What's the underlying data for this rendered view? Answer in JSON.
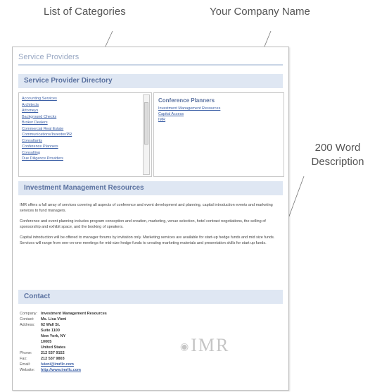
{
  "callouts": {
    "categories": "List of Categories",
    "company": "Your Company Name",
    "description_line1": "200 Word",
    "description_line2": "Description"
  },
  "page": {
    "title": "Service Providers"
  },
  "directory": {
    "heading": "Service Provider Directory",
    "categories": [
      "Accounting Services",
      "Architects",
      "Attorneys",
      "Background Checks",
      "Broker Dealers",
      "Commercial Real Estate",
      "Communications/Investor/PR",
      "Consultants",
      "Conference Planners",
      "Consulting",
      "Due Diligence Providers"
    ],
    "selected": {
      "title": "Conference Planners",
      "links": [
        "Investment Management Resources",
        "Capital Access",
        "IMR"
      ]
    }
  },
  "description": {
    "heading": "Investment Management Resources",
    "paragraphs": [
      "IMR offers a full array of services covering all aspects of conference and event development and planning, capital introduction events and marketing services to fund managers.",
      "Conference and event planning includes program conception and creation, marketing, venue selection, hotel contract negotiations, the selling of sponsorship and exhibit space, and the booking of speakers.",
      "Capital introduction will be offered to manager forums by invitation only. Marketing services are available for start-up hedge funds and mid size funds. Services will range from one-on-one meetings for mid-size hedge funds to creating marketing materials and presentation skills for start up funds."
    ]
  },
  "contact": {
    "heading": "Contact",
    "rows": [
      {
        "label": "Company:",
        "value": "Investment Management Resources"
      },
      {
        "label": "Contact:",
        "value": "Ms. Lisa Vieni"
      },
      {
        "label": "Address:",
        "value": "62 Wall St.\nSuite 1100\nNew York, NY\n10005\nUnited States"
      },
      {
        "label": "Phone:",
        "value": "212 537 9152"
      },
      {
        "label": "Fax:",
        "value": "212 537 9803"
      },
      {
        "label": "Email:",
        "value": "lvieni@imrllc.com"
      },
      {
        "label": "Website:",
        "value": "http://www.imrllc.com"
      }
    ]
  },
  "logo": {
    "text": "IMR",
    "tagline": "Investment Management Resources"
  }
}
